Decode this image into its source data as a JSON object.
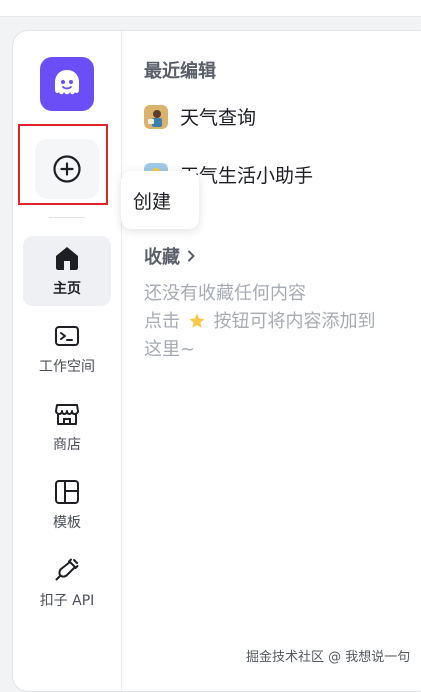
{
  "recent": {
    "title": "最近编辑",
    "items": [
      {
        "name": "天气查询",
        "icon": "weather-app-icon"
      },
      {
        "name": "天气生活小助手",
        "icon": "weather-helper-app-icon"
      }
    ]
  },
  "favorites": {
    "title": "收藏",
    "empty_line1": "还没有收藏任何内容",
    "empty_line2_prefix": "点击",
    "empty_line2_suffix": "按钮可将内容添加到",
    "empty_line3": "这里~"
  },
  "sidebar": {
    "logo_icon": "ghost-logo-icon",
    "create_tooltip": "创建",
    "nav": [
      {
        "label": "主页",
        "icon": "home-icon",
        "active": true
      },
      {
        "label": "工作空间",
        "icon": "workspace-icon"
      },
      {
        "label": "商店",
        "icon": "store-icon"
      },
      {
        "label": "模板",
        "icon": "template-icon"
      },
      {
        "label": "扣子 API",
        "icon": "plugin-api-icon"
      }
    ]
  },
  "watermark": "掘金技术社区 @ 我想说一句",
  "colors": {
    "brand": "#6b4ef5",
    "highlight": "#e0242b",
    "muted_text": "#a7abb4",
    "star": "#f7c948"
  }
}
